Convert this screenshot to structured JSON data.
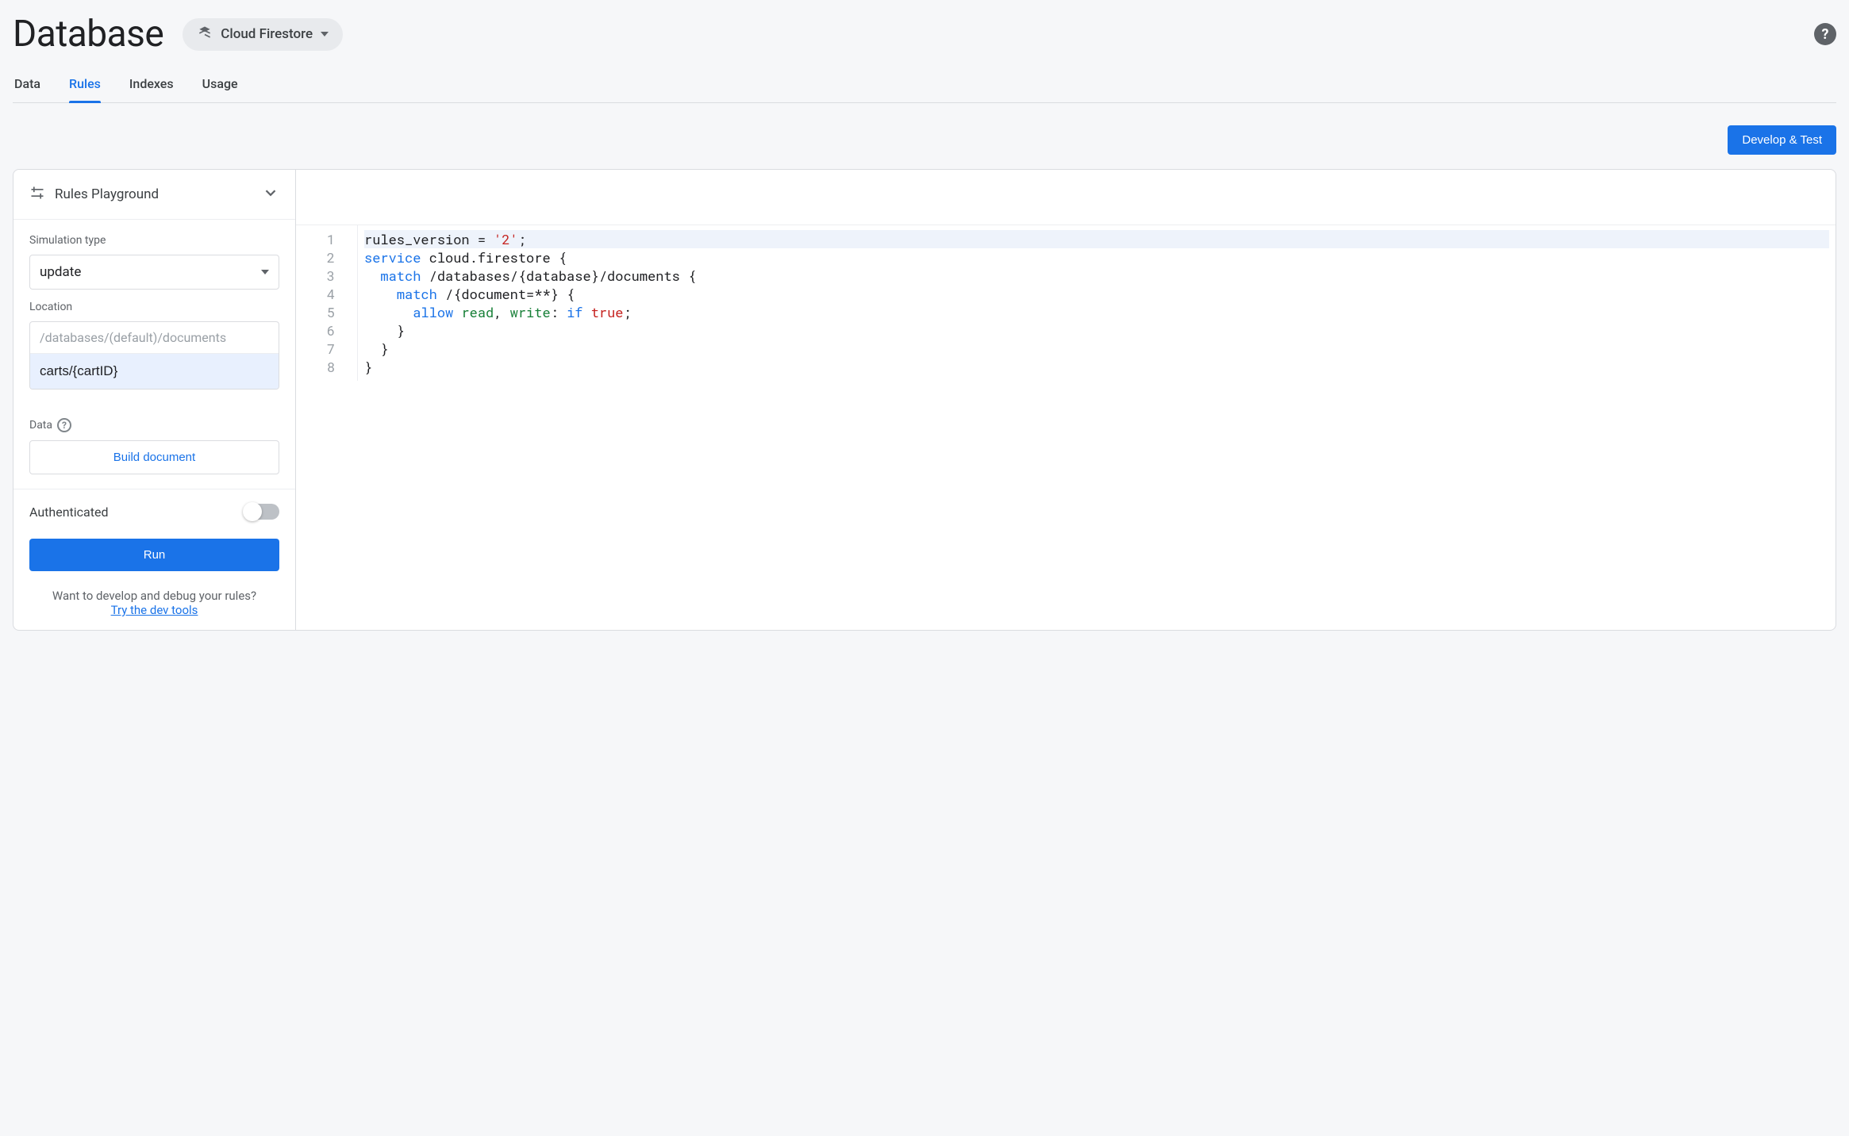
{
  "header": {
    "title": "Database",
    "selector_label": "Cloud Firestore"
  },
  "tabs": [
    {
      "label": "Data",
      "active": false
    },
    {
      "label": "Rules",
      "active": true
    },
    {
      "label": "Indexes",
      "active": false
    },
    {
      "label": "Usage",
      "active": false
    }
  ],
  "actions": {
    "develop_test": "Develop & Test"
  },
  "playground": {
    "title": "Rules Playground",
    "sim_type_label": "Simulation type",
    "sim_type_value": "update",
    "location_label": "Location",
    "location_prefix": "/databases/(default)/documents",
    "location_value": "carts/{cartID}",
    "data_label": "Data",
    "build_doc": "Build document",
    "authenticated_label": "Authenticated",
    "authenticated": false,
    "run": "Run",
    "footer_text": "Want to develop and debug your rules?",
    "footer_link": "Try the dev tools"
  },
  "editor": {
    "lines": [
      "rules_version = '2';",
      "service cloud.firestore {",
      "  match /databases/{database}/documents {",
      "    match /{document=**} {",
      "      allow read, write: if true;",
      "    }",
      "  }",
      "}"
    ]
  }
}
